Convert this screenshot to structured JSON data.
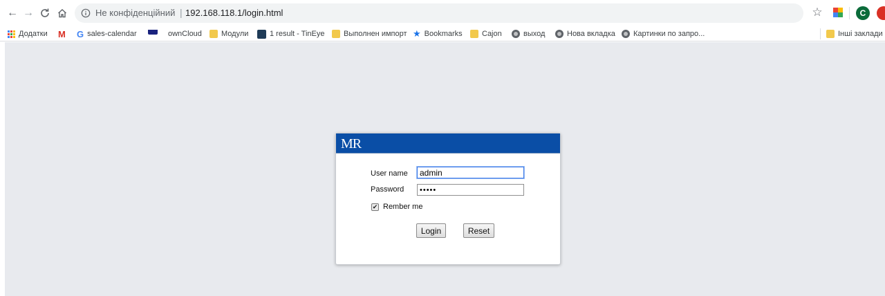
{
  "browser": {
    "url_security_label": "Не конфіденційний",
    "url_separator": "|",
    "url": "192.168.118.1/login.html",
    "profile_initial": "C",
    "nav_back_glyph": "←",
    "nav_forward_glyph": "→",
    "star_glyph": "☆",
    "accent_color": "#1a73e8"
  },
  "bookmarks": {
    "items": [
      {
        "label": "Додатки",
        "icon": "apps-grid-icon"
      },
      {
        "label": "",
        "icon": "gmail-icon"
      },
      {
        "label": "sales-calendar",
        "icon": "google-icon"
      },
      {
        "label": "ownCloud",
        "icon": "owncloud-icon"
      },
      {
        "label": "Модули",
        "icon": "folder-icon"
      },
      {
        "label": "1 result - TinEye",
        "icon": "tineye-icon"
      },
      {
        "label": "Выполнен импорт",
        "icon": "folder-icon"
      },
      {
        "label": "Bookmarks",
        "icon": "star-icon"
      },
      {
        "label": "Cajon",
        "icon": "folder-icon"
      },
      {
        "label": "выход",
        "icon": "globe-icon"
      },
      {
        "label": "Нова вкладка",
        "icon": "globe-icon"
      },
      {
        "label": "Картинки по запро...",
        "icon": "globe-icon"
      }
    ],
    "other": {
      "label": "Інші заклади",
      "icon": "folder-icon"
    },
    "gmail_glyph": "M",
    "google_glyph": "G",
    "bookmarks_star_glyph": "★"
  },
  "login": {
    "title": "MR",
    "header_color": "#0a4ea6",
    "username_label": "User name",
    "username_value": "admin",
    "password_label": "Password",
    "password_value": "•••••",
    "remember_label": "Rember me",
    "remember_checked": true,
    "checkmark_glyph": "✔",
    "login_button": "Login",
    "reset_button": "Reset"
  }
}
